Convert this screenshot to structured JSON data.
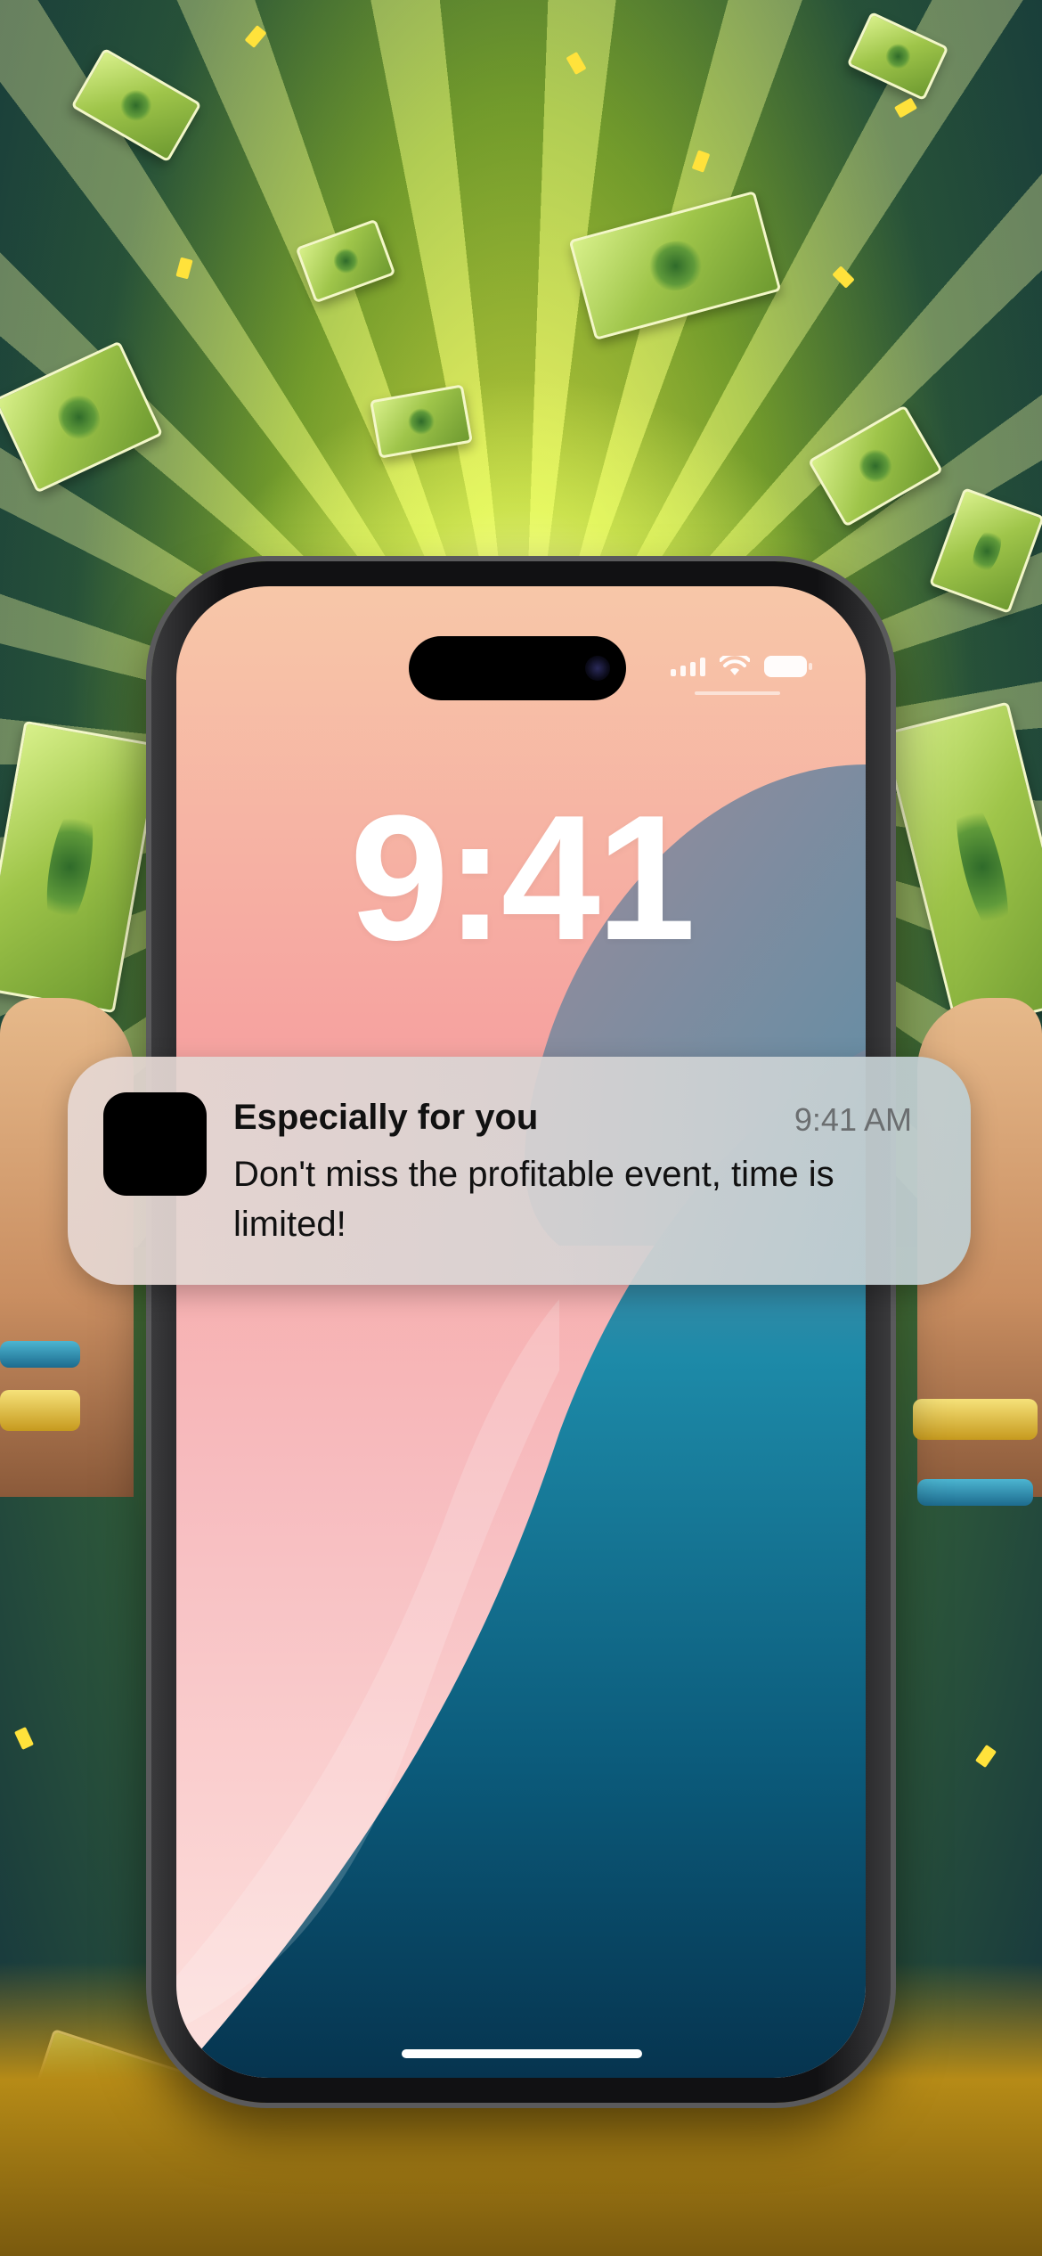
{
  "lock_screen": {
    "time": "9:41"
  },
  "notification": {
    "title": "Especially for you",
    "time": "9:41 AM",
    "body": "Don't miss the profitable event, time is limited!"
  },
  "colors": {
    "background_accent": "#d8e83a",
    "wallpaper_pink": "#f6a3a0",
    "wallpaper_blue": "#0f6a8a",
    "notification_bg": "#d7d4d4"
  }
}
